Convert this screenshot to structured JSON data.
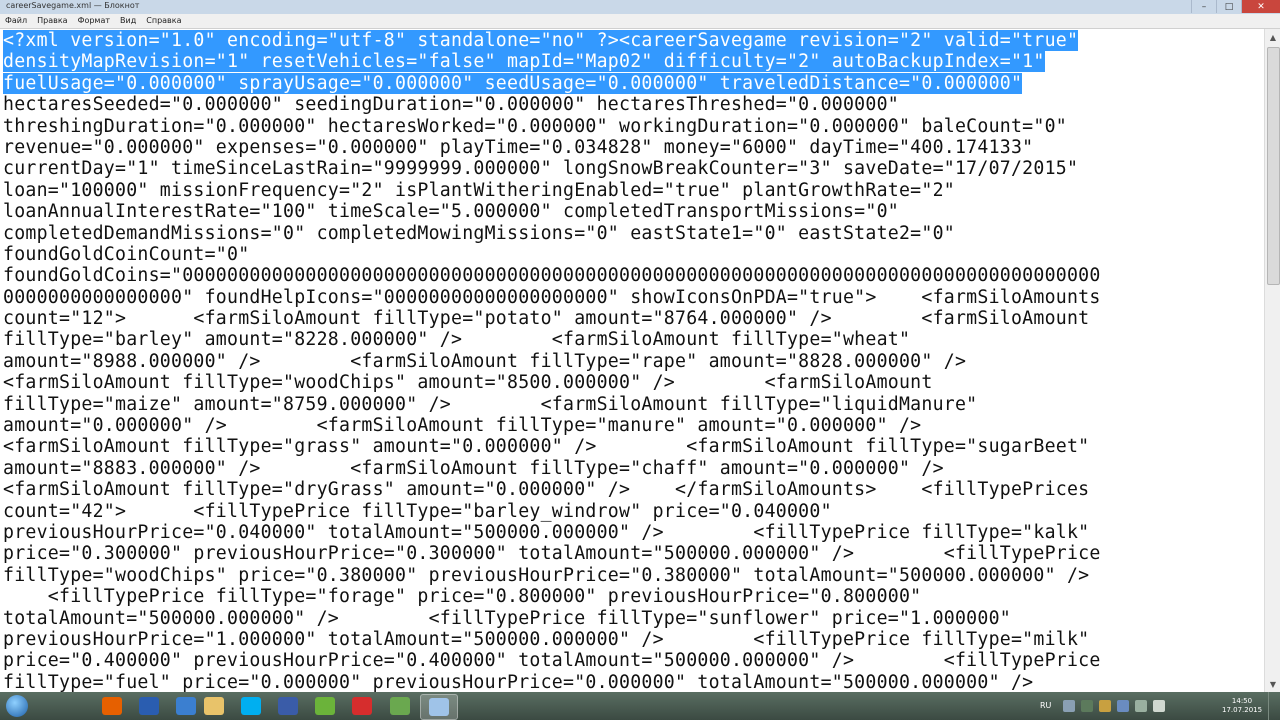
{
  "window": {
    "title": "careerSavegame.xml — Блокнот",
    "controls": {
      "minimize_icon": "–",
      "maximize_icon": "□",
      "close_icon": "✕"
    }
  },
  "menu": [
    "Файл",
    "Правка",
    "Формат",
    "Вид",
    "Справка"
  ],
  "editor": {
    "selected_lines": [
      "<?xml version=\"1.0\" encoding=\"utf-8\" standalone=\"no\" ?><careerSavegame revision=\"2\" valid=\"true\"",
      "densityMapRevision=\"1\" resetVehicles=\"false\" mapId=\"Map02\" difficulty=\"2\" autoBackupIndex=\"1\"",
      "fuelUsage=\"0.000000\" sprayUsage=\"0.000000\" seedUsage=\"0.000000\" traveledDistance=\"0.000000\""
    ],
    "lines": [
      "hectaresSeeded=\"0.000000\" seedingDuration=\"0.000000\" hectaresThreshed=\"0.000000\"",
      "threshingDuration=\"0.000000\" hectaresWorked=\"0.000000\" workingDuration=\"0.000000\" baleCount=\"0\"",
      "revenue=\"0.000000\" expenses=\"0.000000\" playTime=\"0.034828\" money=\"6000\" dayTime=\"400.174133\"",
      "currentDay=\"1\" timeSinceLastRain=\"9999999.000000\" longSnowBreakCounter=\"3\" saveDate=\"17/07/2015\"",
      "loan=\"100000\" missionFrequency=\"2\" isPlantWitheringEnabled=\"true\" plantGrowthRate=\"2\"",
      "loanAnnualInterestRate=\"100\" timeScale=\"5.000000\" completedTransportMissions=\"0\"",
      "completedDemandMissions=\"0\" completedMowingMissions=\"0\" eastState1=\"0\" eastState2=\"0\"",
      "foundGoldCoinCount=\"0\"",
      "foundGoldCoins=\"0000000000000000000000000000000000000000000000000000000000000000000000000000000000",
      "0000000000000000\" foundHelpIcons=\"00000000000000000000\" showIconsOnPDA=\"true\">    <farmSiloAmounts",
      "count=\"12\">      <farmSiloAmount fillType=\"potato\" amount=\"8764.000000\" />        <farmSiloAmount",
      "fillType=\"barley\" amount=\"8228.000000\" />        <farmSiloAmount fillType=\"wheat\"",
      "amount=\"8988.000000\" />        <farmSiloAmount fillType=\"rape\" amount=\"8828.000000\" />",
      "<farmSiloAmount fillType=\"woodChips\" amount=\"8500.000000\" />        <farmSiloAmount",
      "fillType=\"maize\" amount=\"8759.000000\" />        <farmSiloAmount fillType=\"liquidManure\"",
      "amount=\"0.000000\" />        <farmSiloAmount fillType=\"manure\" amount=\"0.000000\" />",
      "<farmSiloAmount fillType=\"grass\" amount=\"0.000000\" />        <farmSiloAmount fillType=\"sugarBeet\"",
      "amount=\"8883.000000\" />        <farmSiloAmount fillType=\"chaff\" amount=\"0.000000\" />",
      "<farmSiloAmount fillType=\"dryGrass\" amount=\"0.000000\" />    </farmSiloAmounts>    <fillTypePrices",
      "count=\"42\">      <fillTypePrice fillType=\"barley_windrow\" price=\"0.040000\"",
      "previousHourPrice=\"0.040000\" totalAmount=\"500000.000000\" />        <fillTypePrice fillType=\"kalk\"",
      "price=\"0.300000\" previousHourPrice=\"0.300000\" totalAmount=\"500000.000000\" />        <fillTypePrice",
      "fillType=\"woodChips\" price=\"0.380000\" previousHourPrice=\"0.380000\" totalAmount=\"500000.000000\" />",
      "    <fillTypePrice fillType=\"forage\" price=\"0.800000\" previousHourPrice=\"0.800000\"",
      "totalAmount=\"500000.000000\" />        <fillTypePrice fillType=\"sunflower\" price=\"1.000000\"",
      "previousHourPrice=\"1.000000\" totalAmount=\"500000.000000\" />        <fillTypePrice fillType=\"milk\"",
      "price=\"0.400000\" previousHourPrice=\"0.400000\" totalAmount=\"500000.000000\" />        <fillTypePrice",
      "fillType=\"fuel\" price=\"0.000000\" previousHourPrice=\"0.000000\" totalAmount=\"500000.000000\" />"
    ]
  },
  "scrollbar": {
    "up_icon": "▲",
    "down_icon": "▼"
  },
  "taskbar": {
    "start_icon": "start-orb",
    "pinned": [
      {
        "name": "firefox-icon",
        "color": "#e66000"
      },
      {
        "name": "winamp-icon",
        "color": "#2a5db0"
      },
      {
        "name": "transfer-icon",
        "color": "#3b7fd0"
      },
      {
        "name": "explorer-icon",
        "color": "#e8c36a"
      },
      {
        "name": "skype-icon",
        "color": "#00aff0"
      },
      {
        "name": "save-icon",
        "color": "#3a5ca8"
      },
      {
        "name": "utorrent-icon",
        "color": "#6bb33a"
      },
      {
        "name": "opera-icon",
        "color": "#d62d2d"
      },
      {
        "name": "installer-icon",
        "color": "#6aa84f"
      },
      {
        "name": "notepad-icon",
        "color": "#9fc3e8"
      }
    ],
    "language": "RU",
    "clock_time": "14:50",
    "clock_date": "17.07.2015"
  }
}
